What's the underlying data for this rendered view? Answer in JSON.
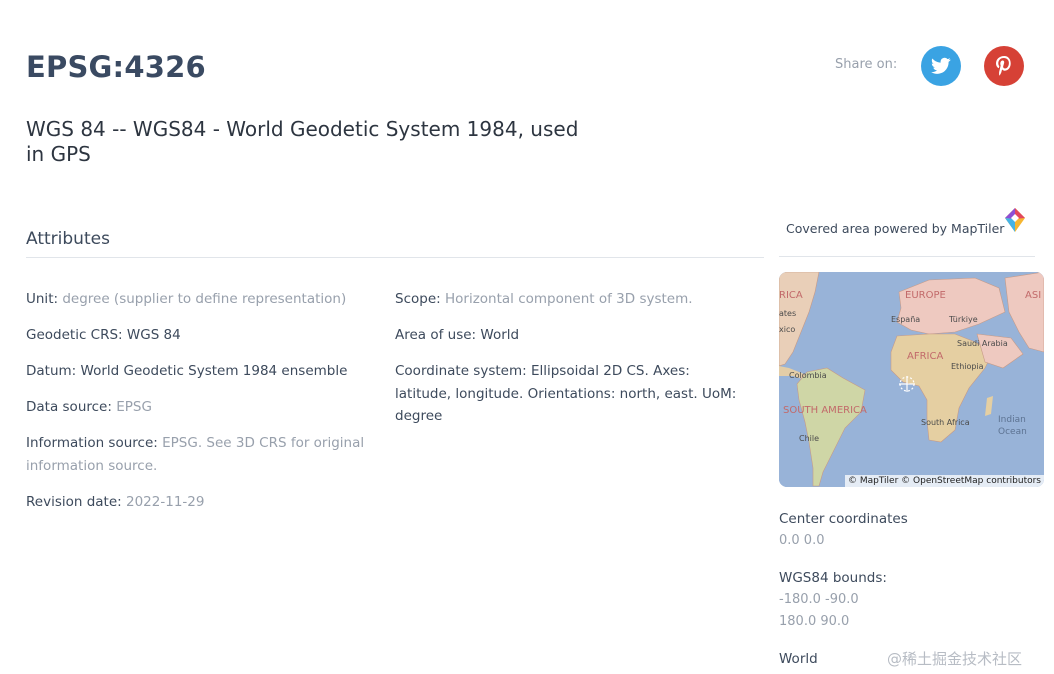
{
  "header": {
    "code": "EPSG:4326",
    "name": "WGS 84 -- WGS84 - World Geodetic System 1984, used in GPS",
    "share_label": "Share on:",
    "share_buttons": [
      {
        "network": "twitter",
        "icon": "twitter-bird-icon",
        "color": "#3aa3e3"
      },
      {
        "network": "pinterest",
        "icon": "pinterest-p-icon",
        "color": "#d64136"
      }
    ]
  },
  "attributes": {
    "heading": "Attributes",
    "left": [
      {
        "label": "Unit:",
        "value": "degree (supplier to define representation)",
        "muted": true
      },
      {
        "label": "Geodetic CRS:",
        "value": "WGS 84",
        "muted": false
      },
      {
        "label": "Datum:",
        "value": "World Geodetic System 1984 ensemble",
        "muted": false
      },
      {
        "label": "Data source:",
        "value": "EPSG",
        "muted": true
      },
      {
        "label": "Information source:",
        "value": "EPSG. See 3D CRS for original information source.",
        "muted": true
      },
      {
        "label": "Revision date:",
        "value": "2022-11-29",
        "muted": true
      }
    ],
    "right": [
      {
        "label": "Scope:",
        "value": "Horizontal component of 3D system.",
        "muted": true
      },
      {
        "label": "Area of use:",
        "value": "World",
        "muted": false
      },
      {
        "label": "Coordinate system:",
        "value": "Ellipsoidal 2D CS. Axes: latitude, longitude. Orientations: north, east. UoM: degree",
        "muted": false
      }
    ]
  },
  "sidebar": {
    "map_caption": "Covered area powered by MapTiler",
    "map_labels": {
      "africa": "AFRICA",
      "europe": "EUROPE",
      "asia": "ASI",
      "south_america": "SOUTH AMERICA",
      "america": "RICA",
      "espana": "España",
      "turkiye": "Türkiye",
      "saudi": "Saudi Arabia",
      "ethiopia": "Ethiopia",
      "colombia": "Colombia",
      "chile": "Chile",
      "south_africa": "South Africa",
      "indian_ocean": "Indian\nOcean",
      "ates": "ates",
      "xico": "xico"
    },
    "map_attribution": "© MapTiler © OpenStreetMap contributors",
    "center_label": "Center coordinates",
    "center_value": "0.0 0.0",
    "bounds_label": "WGS84 bounds:",
    "bounds_min": "-180.0 -90.0",
    "bounds_max": "180.0 90.0",
    "area_name": "World"
  },
  "watermark": "@稀土掘金技术社区",
  "colors": {
    "ocean": "#98b3d8",
    "land": "#e9cfb8",
    "land_green": "#cfd6a6",
    "title": "#3a4a62"
  }
}
